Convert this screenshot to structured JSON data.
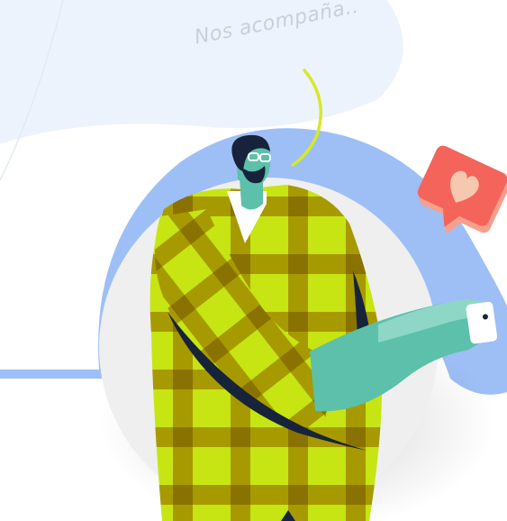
{
  "caption": "Nos acompaña..",
  "colors": {
    "background": "#ffffff",
    "pale_blue": "#ecf3fd",
    "blue_arc": "#9dbff5",
    "circle_gray": "#efefef",
    "coat_light": "#c6e512",
    "coat_dark": "#a79a00",
    "coat_darkest": "#8a7200",
    "skin": "#5cc0aa",
    "sleeve": "#8ed7c6",
    "hair": "#17233a",
    "speech_curve": "#d6e82a",
    "heart_bubble": "#f4645a",
    "heart": "#f6c8b0",
    "caption_text": "#c8cfda"
  },
  "icons": {
    "reaction_bubble": "heart-bubble-icon",
    "phone": "phone-icon"
  }
}
